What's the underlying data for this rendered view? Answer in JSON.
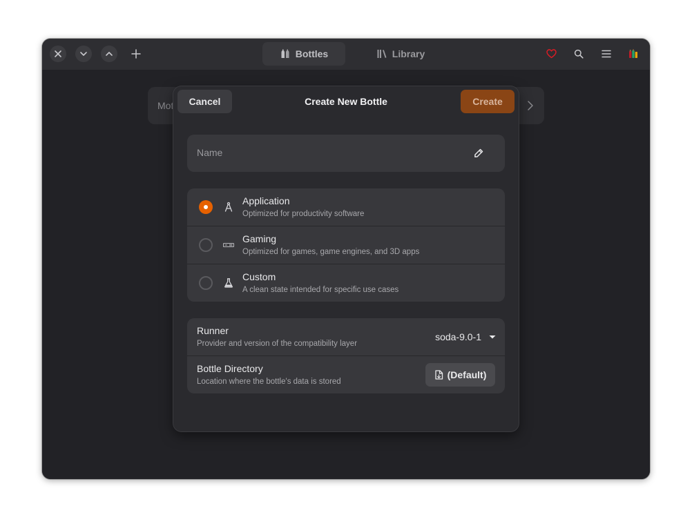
{
  "headerbar": {
    "tabs": [
      {
        "label": "Bottles",
        "active": true
      },
      {
        "label": "Library",
        "active": false
      }
    ],
    "icons": [
      "close-icon",
      "chevron-down-icon",
      "chevron-up-icon",
      "add-icon",
      "heart-icon",
      "search-icon",
      "menu-icon",
      "bottles-app-icon"
    ]
  },
  "background": {
    "banner_text": "Mot"
  },
  "dialog": {
    "title": "Create New Bottle",
    "cancel_label": "Cancel",
    "create_label": "Create",
    "name_placeholder": "Name",
    "name_value": "",
    "environments": [
      {
        "title": "Application",
        "subtitle": "Optimized for productivity software",
        "selected": true,
        "icon": "application-icon"
      },
      {
        "title": "Gaming",
        "subtitle": "Optimized for games, game engines, and 3D apps",
        "selected": false,
        "icon": "gaming-icon"
      },
      {
        "title": "Custom",
        "subtitle": "A clean state intended for specific use cases",
        "selected": false,
        "icon": "flask-icon"
      }
    ],
    "runner": {
      "title": "Runner",
      "subtitle": "Provider and version of the compatibility layer",
      "value": "soda-9.0-1"
    },
    "directory": {
      "title": "Bottle Directory",
      "subtitle": "Location where the bottle's data is stored",
      "button_label": "(Default)"
    }
  },
  "colors": {
    "accent": "#e66100",
    "create_button": "#8a4515",
    "heart": "#e01b24"
  }
}
